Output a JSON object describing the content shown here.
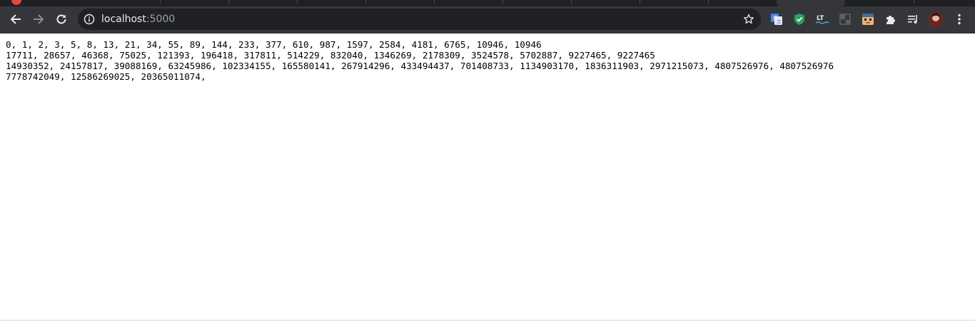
{
  "browser": {
    "url_host": "localhost",
    "url_port": ":5000"
  },
  "extensions": [
    {
      "icon": "google-translate-icon",
      "color": "#4285f4"
    },
    {
      "icon": "adblock-shield-icon",
      "color": "#23a55a"
    },
    {
      "icon": "languagetool-icon",
      "color": "#2c3e50"
    },
    {
      "icon": "grid-extension-icon",
      "color": "#5f6368"
    },
    {
      "icon": "face-extension-icon",
      "color": "#f2b36b"
    },
    {
      "icon": "puzzle-extensions-icon",
      "color": "#e8eaed"
    },
    {
      "icon": "media-queue-icon",
      "color": "#e8eaed"
    }
  ],
  "page": {
    "lines": [
      "0, 1, 2, 3, 5, 8, 13, 21, 34, 55, 89, 144, 233, 377, 610, 987, 1597, 2584, 4181, 6765, 10946, 10946",
      "17711, 28657, 46368, 75025, 121393, 196418, 317811, 514229, 832040, 1346269, 2178309, 3524578, 5702887, 9227465, 9227465",
      "14930352, 24157817, 39088169, 63245986, 102334155, 165580141, 267914296, 433494437, 701408733, 1134903170, 1836311903, 2971215073, 4807526976, 4807526976",
      "7778742049, 12586269025, 20365011074,"
    ]
  }
}
